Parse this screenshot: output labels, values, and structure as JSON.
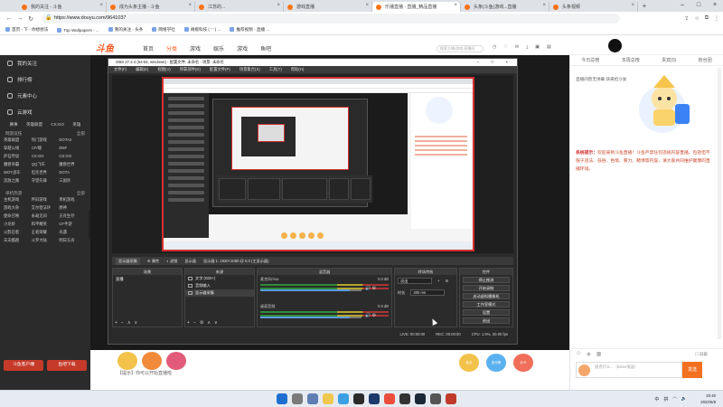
{
  "browser": {
    "tabs": [
      {
        "title": "我的关注 - 斗鱼",
        "active": false
      },
      {
        "title": "成为头条主播 - 斗鱼",
        "active": false
      },
      {
        "title": "江苏的...",
        "active": false
      },
      {
        "title": "游戏直播",
        "active": false
      },
      {
        "title": "乐播直播 - 直播_精品直播",
        "active": true
      },
      {
        "title": "头条(斗鱼)游戏...直播",
        "active": false
      },
      {
        "title": "头条视频",
        "active": false
      }
    ],
    "url": "https://www.douyu.com/9641037",
    "bookmarks": [
      "首页 - 下 - 你想想法",
      "Top Wallpapers - ...",
      "我的关注 - 头条",
      "网络学社",
      "胡椒科技 ( '·' ) ...",
      "推荐视频 - 直播 ..."
    ]
  },
  "douyu": {
    "logo": "斗鱼",
    "nav": [
      "首页",
      "分类",
      "游戏",
      "娱乐",
      "游戏",
      "鱼吧"
    ],
    "search_placeholder": "搜索主播/游戏/直播间",
    "sidebar": {
      "items": [
        "我的关注",
        "排行榜",
        "元素中心",
        "云游戏"
      ],
      "icons": [
        "赛事",
        "英雄联盟",
        "CS:GO",
        "英雄"
      ],
      "section1": {
        "title": "网游竞技",
        "more": "全部"
      },
      "grid1": [
        "英雄联盟",
        "热门游戏",
        "DOTA2",
        "穿越火线",
        "CF/端",
        "DNF",
        "炉石传说",
        "CS:GO",
        "CS:GO",
        "魔兽争霸",
        "QQ飞车",
        "魔兽世界",
        "WOT战车",
        "坦克世界",
        "DOTA",
        "流放之路",
        "守望先锋",
        "三国杀"
      ],
      "section2": {
        "title": "单机热游",
        "more": "全部"
      },
      "grid2": [
        "主机游戏",
        "怀旧游戏",
        "单机游戏",
        "游戏大杂",
        "艾尔登法环",
        "原神",
        "使命召唤",
        "永劫无间",
        "方舟生存",
        "小龙虾",
        "和平精英",
        "CF手游",
        "火影忍者",
        "王者荣耀",
        "光遇",
        "天天酷跑",
        "斗罗大陆",
        "明日方舟"
      ],
      "btn_left": "斗鱼客户端",
      "btn_right": "鱼吧下载"
    },
    "room": {
      "chat_hint": "【提示】你可以开始直播啦",
      "gifts": [
        "鱼丸",
        "荧光棒",
        "办卡"
      ]
    },
    "chat": {
      "tabs": [
        "今日总榜",
        "本周总榜",
        "贵宾(0)",
        "粉丝团"
      ],
      "hint": "直播间暂无弹幕 快来抢沙发",
      "system_label": "系统提示：",
      "system_text": "欢迎来到斗鱼直播！斗鱼严禁任何违规内容直播，包括但不限于违法、低俗、色情、暴力、赌博等内容，请大家共同维护健康的直播环境。",
      "input_placeholder": "说点什么...（Enter发送）",
      "send": "发送",
      "block_label": "屏蔽"
    }
  },
  "obs": {
    "title": "OBS 27.2.4 (64-bit, windows) - 配置文件: 未命名 - 场景: 未命名",
    "menu": [
      "文件(F)",
      "编辑(E)",
      "视图(V)",
      "停靠部件(D)",
      "配置文件(P)",
      "场景集合(S)",
      "工具(T)",
      "帮助(H)"
    ],
    "toolbar": [
      "显示器采集",
      "属性",
      "滤镜",
      "显示器",
      "显示器 1: 1920×1080 @ 0,0 (主显示器)"
    ],
    "docks": {
      "scenes": "场景",
      "sources": "来源",
      "mixer": "混音器",
      "transitions": "转场特效",
      "controls": "控件"
    },
    "scene_items": [
      "直播"
    ],
    "sources": [
      "文字 (GDI+)",
      "音频输入",
      "显示器采集"
    ],
    "mixer": [
      {
        "name": "麦克风/Aux",
        "db": "0.0 dB",
        "level": 0.88
      },
      {
        "name": "桌面音频",
        "db": "0.0 dB",
        "level": 0.88
      }
    ],
    "transition": {
      "name": "淡出",
      "duration_label": "时长",
      "duration": "300 ms"
    },
    "controls": [
      "停止推流",
      "开始录制",
      "启动虚拟摄像机",
      "工作室模式",
      "设置",
      "退出"
    ],
    "status": [
      "LIVE: 00:00:00",
      "REC: 00:00:00",
      "CPU: 1.9%, 30.00 fps"
    ]
  },
  "taskbar": {
    "time": "20:40",
    "date": "2022/6/8",
    "tray": [
      "中",
      "拼",
      "wifi",
      "音量"
    ]
  }
}
